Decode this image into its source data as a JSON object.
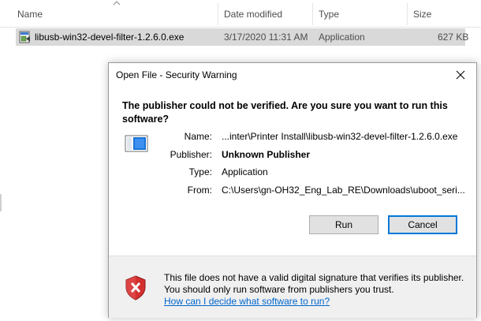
{
  "explorer": {
    "columns": {
      "name": "Name",
      "date_modified": "Date modified",
      "type": "Type",
      "size": "Size"
    },
    "file": {
      "name": "libusb-win32-devel-filter-1.2.6.0.exe",
      "date_modified": "3/17/2020 11:31 AM",
      "type": "Application",
      "size": "627 KB",
      "icon": "installer-exe-icon"
    }
  },
  "dialog": {
    "title": "Open File - Security Warning",
    "question": "The publisher could not be verified.  Are you sure you want to run this software?",
    "fields": {
      "name_label": "Name:",
      "name_value": "...inter\\Printer Install\\libusb-win32-devel-filter-1.2.6.0.exe",
      "publisher_label": "Publisher:",
      "publisher_value": "Unknown Publisher",
      "type_label": "Type:",
      "type_value": "Application",
      "from_label": "From:",
      "from_value": "C:\\Users\\gn-OH32_Eng_Lab_RE\\Downloads\\uboot_seri..."
    },
    "buttons": {
      "run": "Run",
      "cancel": "Cancel"
    },
    "footer": {
      "warning_text": "This file does not have a valid digital signature that verifies its publisher.  You should only run software from publishers you trust.",
      "help_link": "How can I decide what software to run?"
    }
  },
  "colors": {
    "accent": "#0078d7",
    "link": "#0066cc",
    "shield_red": "#d32f2f",
    "selection": "#d9d9d9"
  }
}
